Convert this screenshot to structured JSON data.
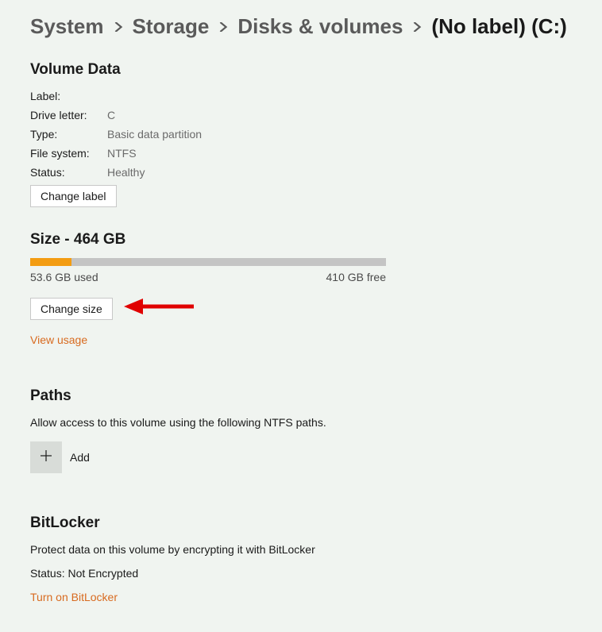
{
  "breadcrumb": {
    "items": [
      "System",
      "Storage",
      "Disks & volumes",
      "(No label) (C:)"
    ]
  },
  "volume": {
    "heading": "Volume Data",
    "rows": {
      "label_lbl": "Label:",
      "label_val": "",
      "drive_lbl": "Drive letter:",
      "drive_val": "C",
      "type_lbl": "Type:",
      "type_val": "Basic data partition",
      "fs_lbl": "File system:",
      "fs_val": "NTFS",
      "status_lbl": "Status:",
      "status_val": "Healthy"
    },
    "change_label_btn": "Change label"
  },
  "size": {
    "title": "Size - 464 GB",
    "used": "53.6 GB used",
    "free": "410 GB free",
    "used_percent": 11.5,
    "change_size_btn": "Change size",
    "view_usage": "View usage"
  },
  "paths": {
    "heading": "Paths",
    "desc": "Allow access to this volume using the following NTFS paths.",
    "add_label": "Add"
  },
  "bitlocker": {
    "heading": "BitLocker",
    "desc": "Protect data on this volume by encrypting it with BitLocker",
    "status": "Status: Not Encrypted",
    "turn_on": "Turn on BitLocker"
  }
}
